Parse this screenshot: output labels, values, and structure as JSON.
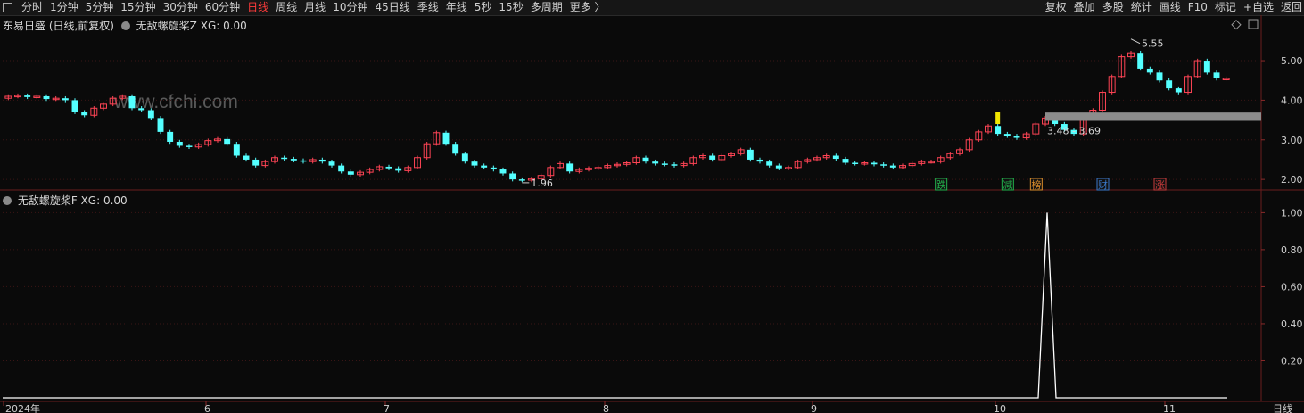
{
  "toolbar": {
    "periods": [
      "分时",
      "1分钟",
      "5分钟",
      "15分钟",
      "30分钟",
      "60分钟",
      "日线",
      "周线",
      "月线",
      "10分钟",
      "45日线",
      "季线",
      "年线",
      "5秒",
      "15秒",
      "多周期",
      "更多 〉"
    ],
    "active_period": "日线",
    "right_tools": [
      "复权",
      "叠加",
      "多股",
      "统计",
      "画线",
      "F10",
      "标记",
      "+自选",
      "返回"
    ]
  },
  "main_chart": {
    "title": "东易日盛 (日线,前复权)",
    "indicator_name": "无敌螺旋桨Z",
    "indicator_value": "XG: 0.00",
    "watermark": "www.cfchi.com",
    "y_ticks": [
      "5.00",
      "4.00",
      "3.00",
      "2.00"
    ],
    "high_label": "5.55",
    "low_label": "1.96",
    "zone_label": "3.48 - 3.69",
    "markers": [
      {
        "text": "跌",
        "color": "#22b14c"
      },
      {
        "text": "减",
        "color": "#22b14c"
      },
      {
        "text": "榜",
        "color": "#d98c2b"
      },
      {
        "text": "财",
        "color": "#3a78c9"
      },
      {
        "text": "涨",
        "color": "#c83a3a"
      }
    ]
  },
  "sub_chart": {
    "indicator_name": "无敌螺旋桨F",
    "indicator_value": "XG: 0.00",
    "y_ticks": [
      "1.00",
      "0.80",
      "0.60",
      "0.40",
      "0.20"
    ]
  },
  "x_axis": {
    "labels": [
      "2024年",
      "6",
      "7",
      "8",
      "9",
      "10",
      "11"
    ],
    "right_label": "日线"
  },
  "colors": {
    "up": "#ff4455",
    "down": "#54ffff",
    "background": "#0a0a0a",
    "grid": "#3a1a1a"
  },
  "chart_data": {
    "type": "candlestick",
    "series_main": {
      "name": "东易日盛",
      "close_approx": [
        4.1,
        4.12,
        4.08,
        4.1,
        4.03,
        4.05,
        4.0,
        3.7,
        3.62,
        3.8,
        3.9,
        4.05,
        4.1,
        3.8,
        3.75,
        3.55,
        3.2,
        2.95,
        2.85,
        2.82,
        2.88,
        2.98,
        3.02,
        2.9,
        2.6,
        2.5,
        2.35,
        2.45,
        2.55,
        2.52,
        2.48,
        2.45,
        2.5,
        2.45,
        2.35,
        2.2,
        2.12,
        2.18,
        2.25,
        2.32,
        2.28,
        2.22,
        2.3,
        2.55,
        2.9,
        3.18,
        2.9,
        2.65,
        2.45,
        2.35,
        2.3,
        2.25,
        2.15,
        2.0,
        1.98,
        2.02,
        2.1,
        2.3,
        2.4,
        2.2,
        2.25,
        2.28,
        2.3,
        2.35,
        2.38,
        2.42,
        2.55,
        2.45,
        2.4,
        2.38,
        2.35,
        2.4,
        2.55,
        2.6,
        2.5,
        2.6,
        2.65,
        2.75,
        2.5,
        2.45,
        2.35,
        2.28,
        2.3,
        2.45,
        2.5,
        2.55,
        2.6,
        2.52,
        2.42,
        2.4,
        2.42,
        2.38,
        2.35,
        2.3,
        2.35,
        2.4,
        2.45,
        2.45,
        2.55,
        2.65,
        2.75,
        3.0,
        3.2,
        3.35,
        3.15,
        3.1,
        3.05,
        3.15,
        3.4,
        3.55,
        3.4,
        3.25,
        3.15,
        3.6,
        3.75,
        4.2,
        4.6,
        5.1,
        5.2,
        4.8,
        4.7,
        4.5,
        4.3,
        4.2,
        4.6,
        5.0,
        4.7,
        4.55,
        4.55
      ]
    },
    "series_sub": {
      "name": "无敌螺旋桨F",
      "note_values": "0 everywhere except a single spike",
      "spike_value": 1.0
    },
    "y_range_main": [
      1.8,
      5.7
    ],
    "y_range_sub": [
      0,
      1.05
    ]
  }
}
